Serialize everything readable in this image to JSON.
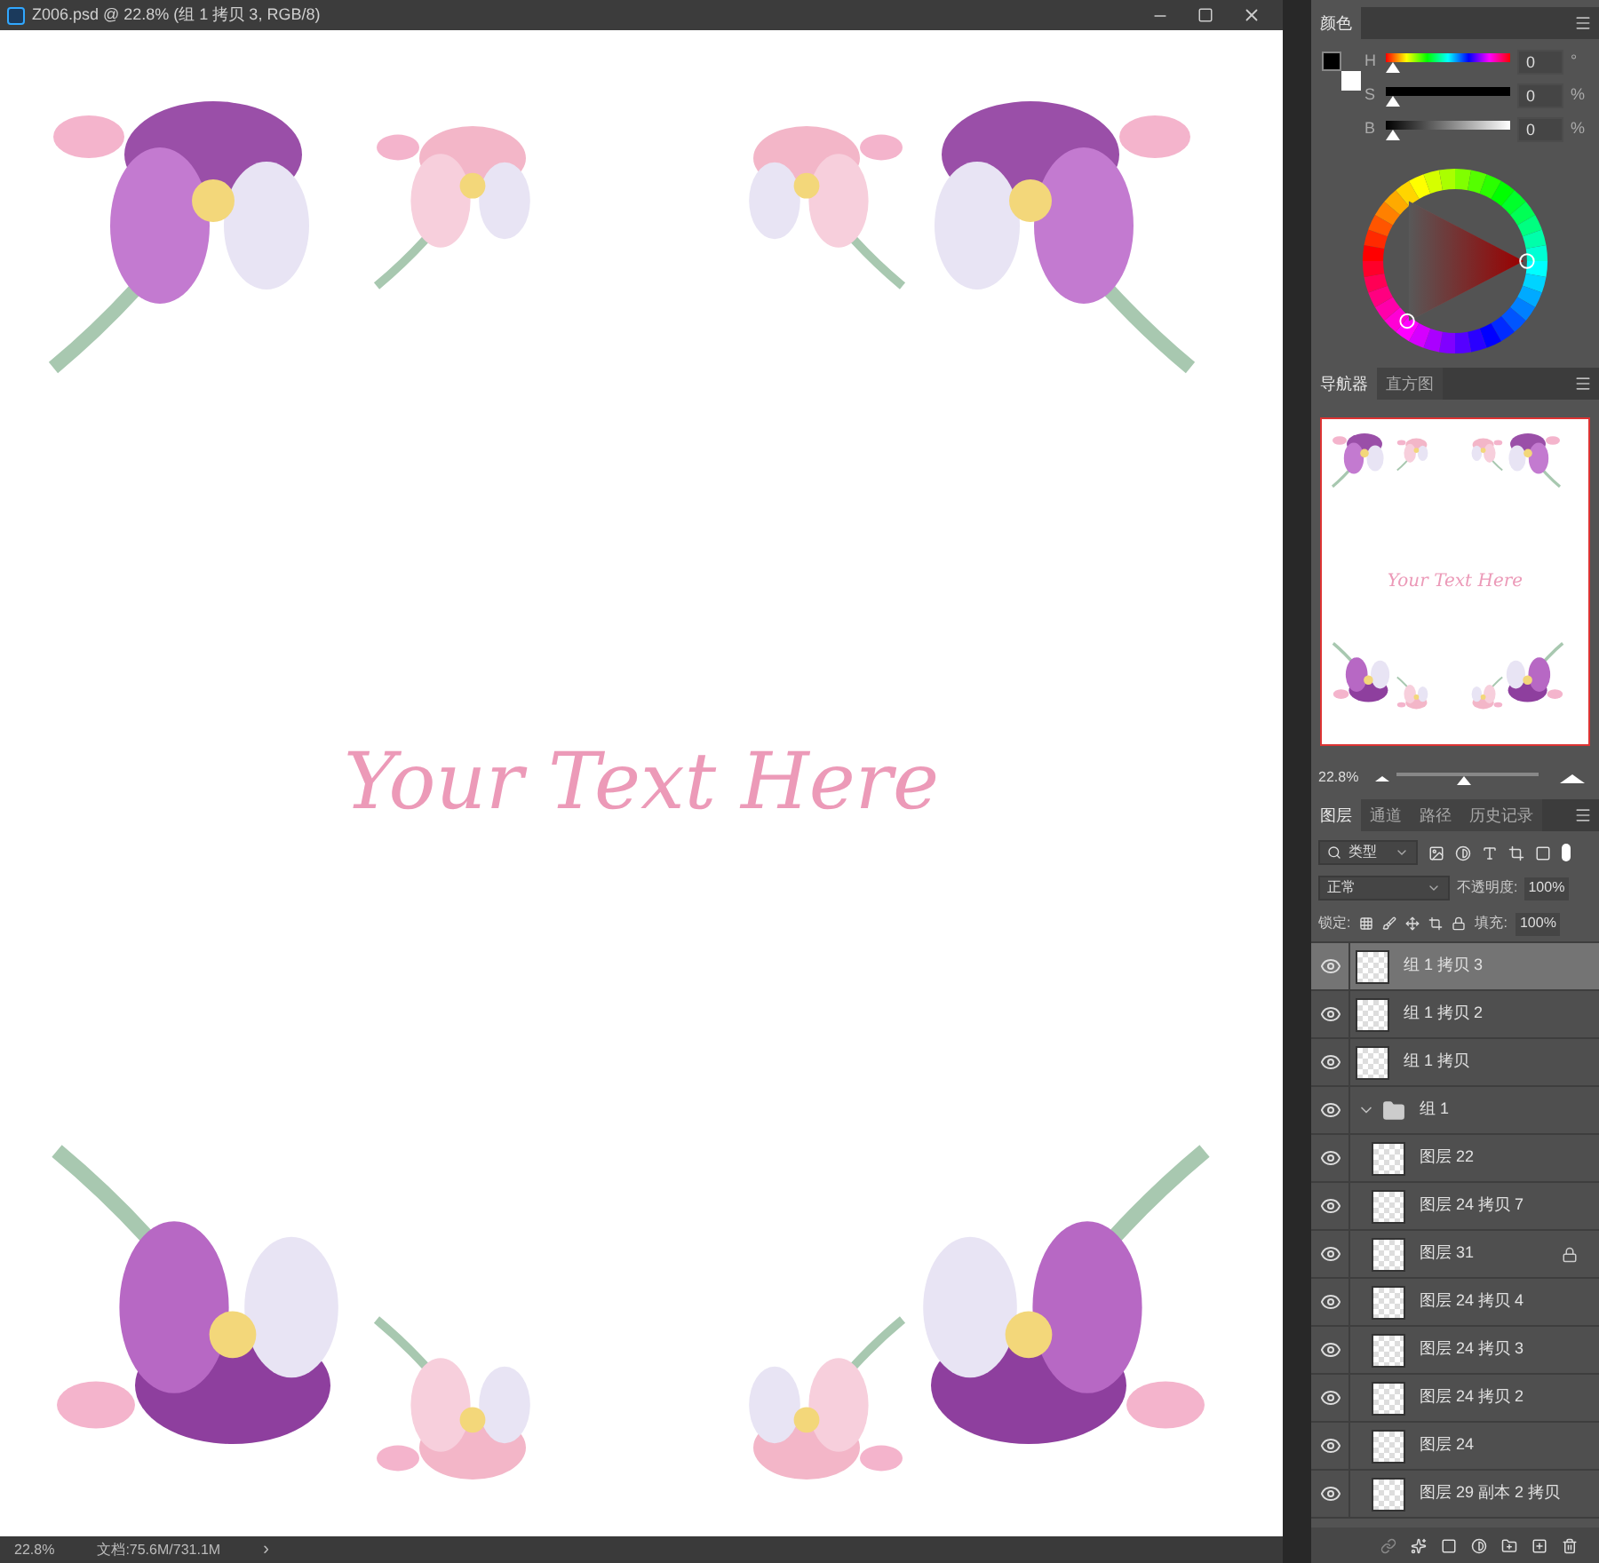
{
  "document": {
    "title": "Z006.psd @ 22.8% (组 1 拷贝 3, RGB/8)",
    "canvas_text": "Your Text Here",
    "status_zoom": "22.8%",
    "status_info": "文档:75.6M/731.1M",
    "status_arrow": "›"
  },
  "color_panel": {
    "tab": "颜色",
    "channels": [
      {
        "label": "H",
        "value": "0",
        "unit": "°",
        "level": 0
      },
      {
        "label": "S",
        "value": "0",
        "unit": "%",
        "level": 0
      },
      {
        "label": "B",
        "value": "0",
        "unit": "%",
        "level": 0
      }
    ]
  },
  "navigator_panel": {
    "tabs": [
      {
        "label": "导航器",
        "selected": true
      },
      {
        "label": "直方图",
        "selected": false
      }
    ],
    "thumbnail_text": "Your Text Here",
    "zoom": "22.8%",
    "level": 0.45
  },
  "layers_panel": {
    "tabs": [
      {
        "label": "图层",
        "selected": true
      },
      {
        "label": "通道",
        "selected": false
      },
      {
        "label": "路径",
        "selected": false
      },
      {
        "label": "历史记录",
        "selected": false
      }
    ],
    "filter": "类型",
    "blend_mode": "正常",
    "opacity_label": "不透明度:",
    "opacity": "100%",
    "lock_label": "锁定:",
    "fill_label": "填充:",
    "fill": "100%",
    "layers": [
      {
        "kind": "layer",
        "name": "组 1 拷贝 3",
        "selected": true,
        "visible": true,
        "locked": false
      },
      {
        "kind": "layer",
        "name": "组 1 拷贝 2",
        "selected": false,
        "visible": true,
        "locked": false
      },
      {
        "kind": "layer",
        "name": "组 1 拷贝",
        "selected": false,
        "visible": true,
        "locked": false
      },
      {
        "kind": "group",
        "name": "组 1",
        "selected": false,
        "visible": true,
        "locked": false,
        "expanded": true,
        "children": [
          {
            "kind": "layer",
            "name": "图层 22",
            "selected": false,
            "visible": true,
            "locked": false
          },
          {
            "kind": "layer",
            "name": "图层 24 拷贝 7",
            "selected": false,
            "visible": true,
            "locked": false
          },
          {
            "kind": "layer",
            "name": "图层 31",
            "selected": false,
            "visible": true,
            "locked": true
          },
          {
            "kind": "layer",
            "name": "图层 24 拷贝 4",
            "selected": false,
            "visible": true,
            "locked": false
          },
          {
            "kind": "layer",
            "name": "图层 24 拷贝 3",
            "selected": false,
            "visible": true,
            "locked": false
          },
          {
            "kind": "layer",
            "name": "图层 24 拷贝 2",
            "selected": false,
            "visible": true,
            "locked": false
          },
          {
            "kind": "layer",
            "name": "图层 24",
            "selected": false,
            "visible": true,
            "locked": false
          },
          {
            "kind": "layer",
            "name": "图层 29 副本 2 拷贝",
            "selected": false,
            "visible": true,
            "locked": false
          }
        ]
      }
    ]
  }
}
